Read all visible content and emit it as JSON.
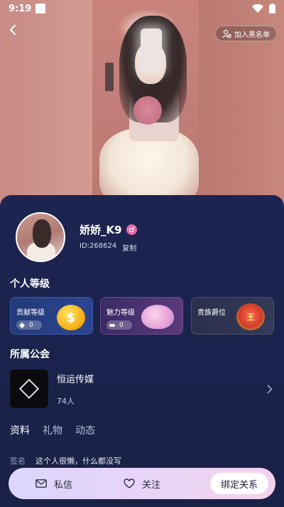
{
  "status_bar": {
    "time": "9:19"
  },
  "header": {
    "blacklist_label": "加入黑名单"
  },
  "profile": {
    "username": "娇娇_K9",
    "id_text": "ID:268624",
    "copy_label": "复制"
  },
  "levels": {
    "title": "个人等级",
    "items": [
      {
        "label": "贡献等级",
        "value": "0"
      },
      {
        "label": "魅力等级",
        "value": "0"
      },
      {
        "label": "贵族爵位"
      }
    ]
  },
  "guild": {
    "title": "所属公会",
    "name": "恒运传媒",
    "members": "74人",
    "logo_text": "恒运传媒"
  },
  "tabs": [
    {
      "label": "资料",
      "active": true
    },
    {
      "label": "礼物",
      "active": false
    },
    {
      "label": "动态",
      "active": false
    }
  ],
  "signature": {
    "key": "签名",
    "value": "这个人很懒，什么都没写"
  },
  "bottom_bar": {
    "message_label": "私信",
    "follow_label": "关注",
    "bind_label": "绑定关系"
  },
  "colors": {
    "card_bg": "#1a2147",
    "pink_badge": "#e86aa6",
    "bottom_bar_start": "#dcd6ff",
    "bottom_bar_end": "#f3d2ec"
  },
  "icons": [
    "wifi-icon",
    "battery-icon",
    "back-arrow-icon",
    "user-block-icon",
    "female-badge-icon",
    "coin-icon",
    "heart-icon",
    "medal-icon",
    "chevron-right-icon",
    "mail-icon",
    "heart-outline-icon"
  ]
}
